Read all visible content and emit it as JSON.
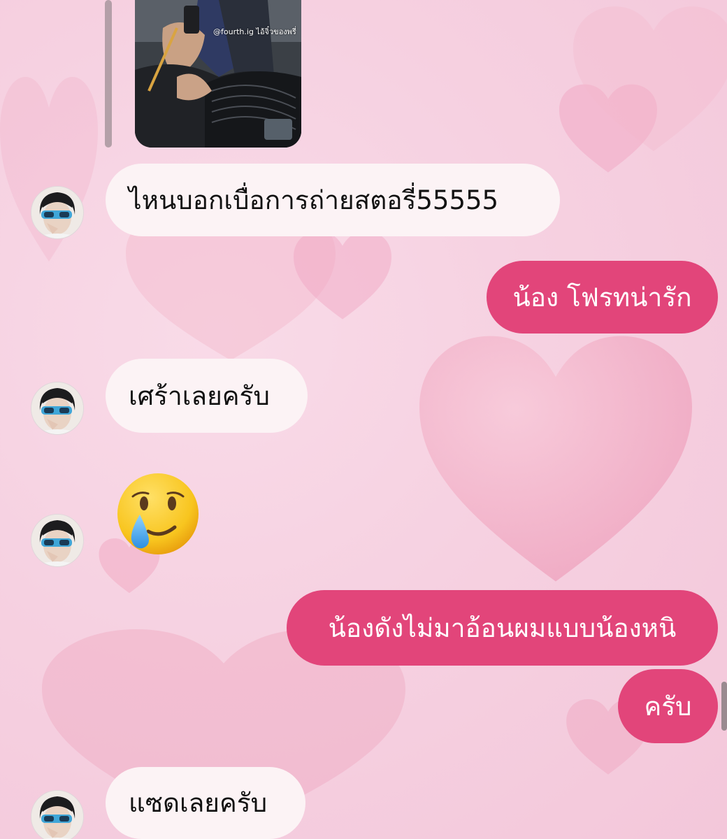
{
  "chat": {
    "shared_image": {
      "caption": "@fourth.ig ไอ้จิ๋วของพรี่"
    },
    "messages": [
      {
        "direction": "incoming",
        "text": "ไหนบอกเบื่อการถ่ายสตอรี่55555"
      },
      {
        "direction": "outgoing",
        "text": "น้อง โฟรทน่ารัก"
      },
      {
        "direction": "incoming",
        "text": "เศร้าเลยครับ"
      },
      {
        "direction": "incoming",
        "text": "🥲",
        "kind": "emoji",
        "icon": "smiling-face-with-tear-icon"
      },
      {
        "direction": "outgoing",
        "text": "น้องดังไม่มาอ้อนผมแบบน้องหนิ"
      },
      {
        "direction": "outgoing",
        "text": "ครับ"
      },
      {
        "direction": "incoming",
        "text": "แซดเลยครับ"
      }
    ]
  },
  "colors": {
    "background": "#f6d1e1",
    "incoming_bubble": "#fcf3f5",
    "outgoing_bubble": "#e2457a",
    "incoming_text": "#111111",
    "outgoing_text": "#ffffff"
  }
}
